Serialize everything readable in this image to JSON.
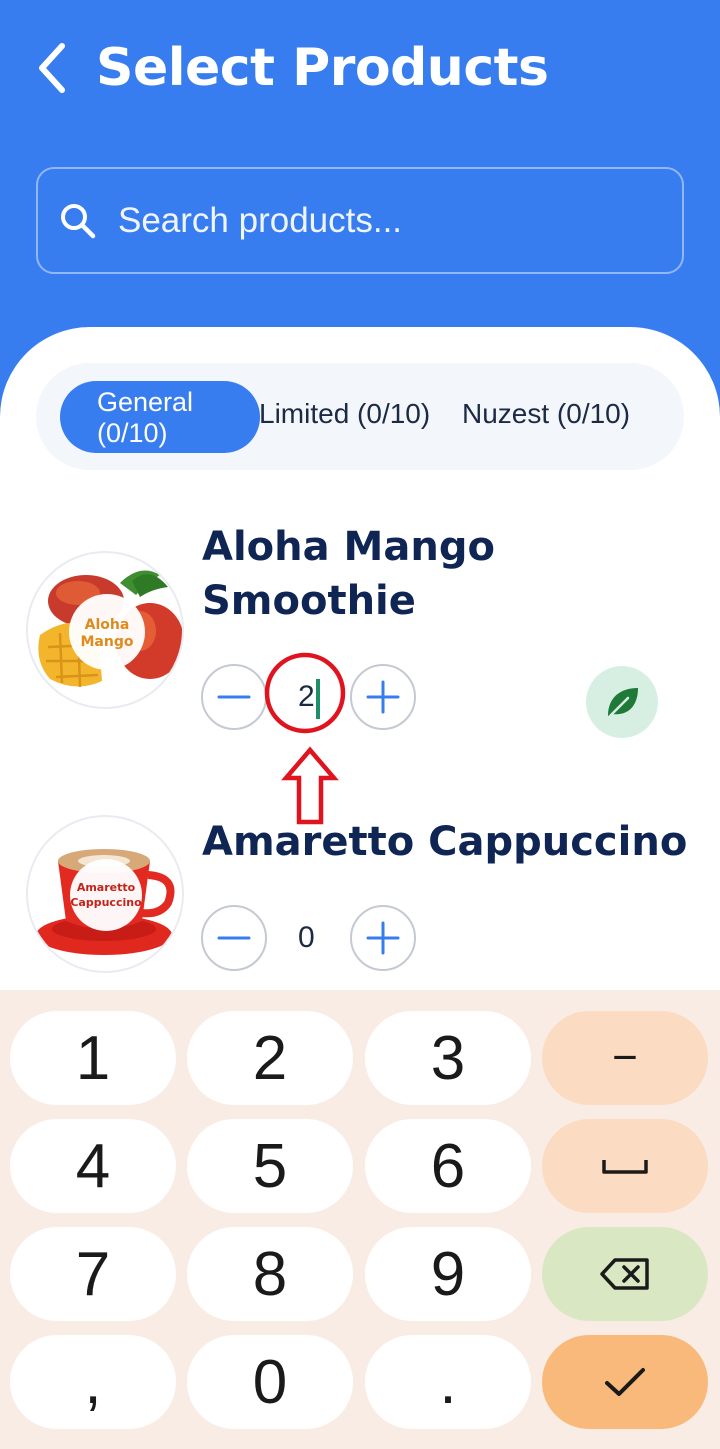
{
  "header": {
    "title": "Select Products",
    "search_placeholder": "Search products..."
  },
  "tabs": [
    {
      "label": "General\n(0/10)",
      "active": true
    },
    {
      "label": "Limited (0/10)",
      "active": false
    },
    {
      "label": "Nuzest (0/10)",
      "active": false
    }
  ],
  "products": [
    {
      "name": "Aloha Mango Smoothie",
      "image_label": "Aloha\nMango",
      "quantity": "2"
    },
    {
      "name": "Amaretto Cappuccino",
      "image_label": "Amaretto\nCappuccino",
      "quantity": "0"
    }
  ],
  "keyboard": {
    "keys": [
      "1",
      "2",
      "3",
      "−",
      "4",
      "5",
      "6",
      "␣",
      "7",
      "8",
      "9",
      "⌫",
      ",",
      "0",
      ".",
      "✓"
    ]
  },
  "colors": {
    "primary": "#377df0",
    "title_text": "#0f2554",
    "annotation": "#e0141e",
    "keyboard_bg": "#f8ece4"
  }
}
